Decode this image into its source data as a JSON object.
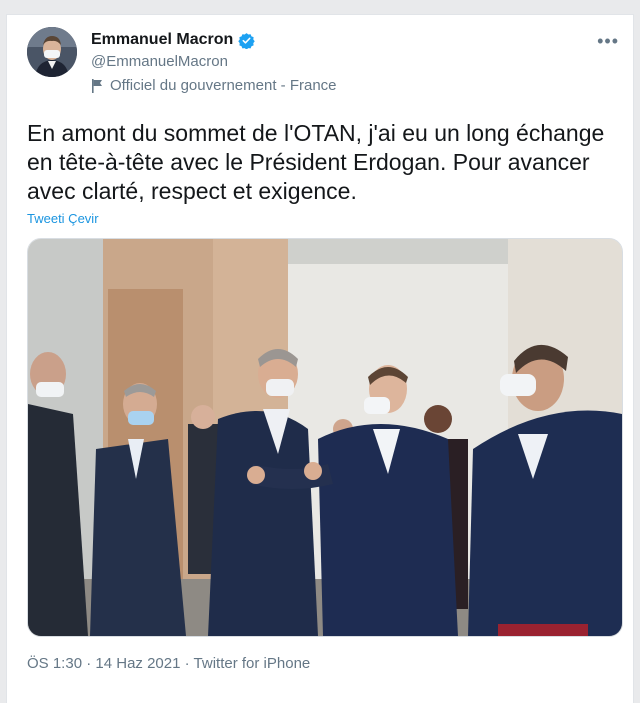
{
  "tweet": {
    "author_name": "Emmanuel Macron",
    "author_handle": "@EmmanuelMacron",
    "account_label": "Officiel du gouvernement - France",
    "text": "En amont du sommet de l'OTAN, j'ai eu un long échange en tête-à-tête avec le Président Erdogan. Pour avancer avec clarté, respect et exigence.",
    "translate_label": "Tweeti Çevir",
    "time": "ÖS 1:30",
    "separator": "·",
    "date": "14 Haz 2021",
    "source": "Twitter for iPhone",
    "more_icon": "more-horizontal-icon",
    "verified_icon": "verified-badge-icon",
    "label_icon": "flag-icon"
  },
  "colors": {
    "accent": "#1da1f2",
    "link": "#1b95e0",
    "secondary_text": "#657786",
    "primary_text": "#14171a"
  }
}
